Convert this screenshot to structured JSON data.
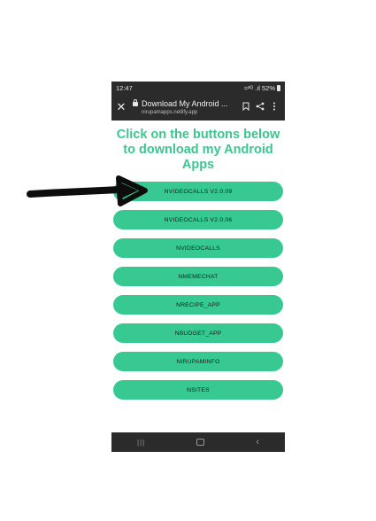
{
  "status_bar": {
    "time": "12:47",
    "signal_text": "≈³ᴳ .ıl",
    "battery": "52%"
  },
  "browser": {
    "page_title": "Download My Android ...",
    "url": "nirupamapps.netlify.app",
    "close_icon": "close-icon",
    "bookmark_icon": "bookmark-icon",
    "share_icon": "share-icon",
    "menu_icon": "more-vert-icon"
  },
  "heading": {
    "line1": "Click on the buttons below",
    "line2": "to download my Android",
    "line3": "Apps"
  },
  "buttons": [
    {
      "label": "NVIDEOCALLS V2.0.09"
    },
    {
      "label": "NVIDEOCALLS V2.0.06"
    },
    {
      "label": "NVIDEOCALLS"
    },
    {
      "label": "NMEMECHAT"
    },
    {
      "label": "NRECIPE_APP"
    },
    {
      "label": "NBUDGET_APP"
    },
    {
      "label": "NIRUPAMINFO"
    },
    {
      "label": "NSITES"
    }
  ],
  "nav_bar": {
    "recents_icon": "recents-icon",
    "home_icon": "home-icon",
    "back_icon": "back-icon"
  },
  "colors": {
    "accent": "#38c892",
    "heading": "#3cc590",
    "bar": "#2b2b2b",
    "arrow": "#0d0d0d"
  }
}
